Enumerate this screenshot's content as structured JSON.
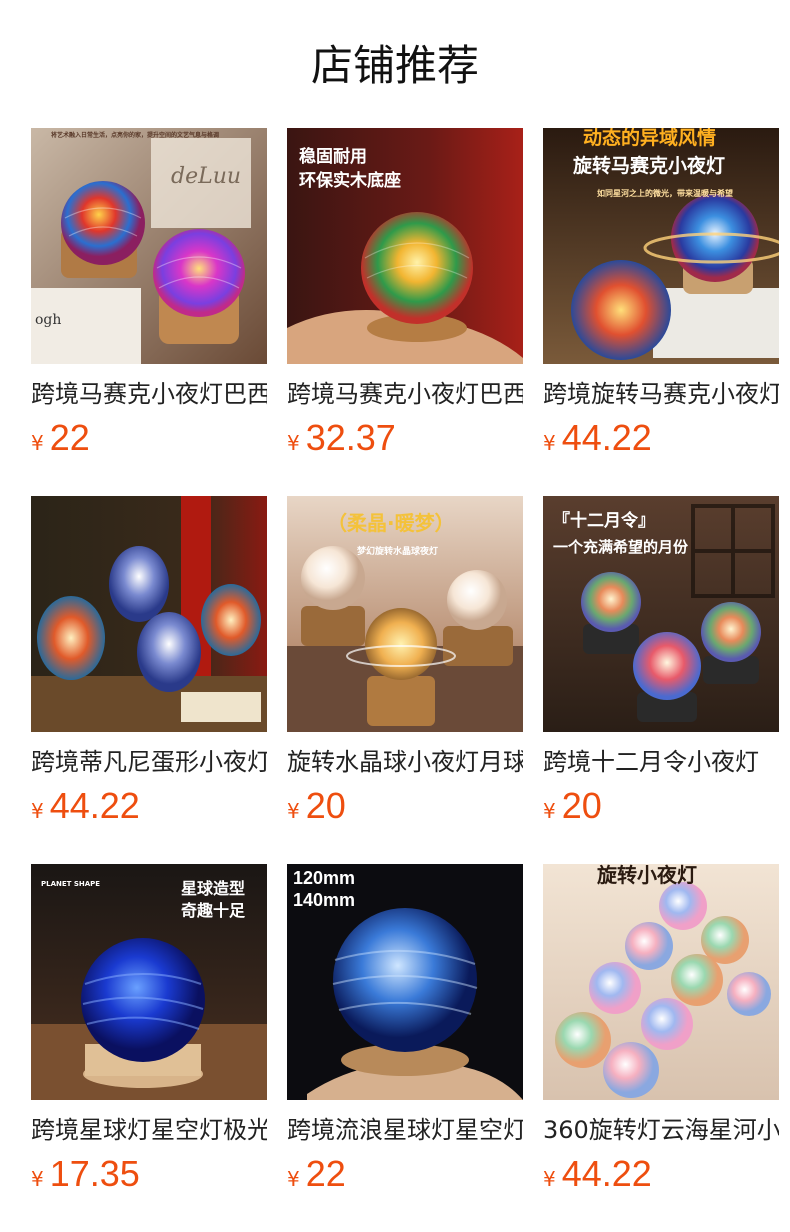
{
  "header": {
    "title": "店铺推荐"
  },
  "currency_symbol": "¥",
  "products": [
    {
      "name": "跨境马赛克小夜灯巴西",
      "price": "22",
      "image": {
        "subject": "mosaic-egg-lamps",
        "overlay": "将艺术融入日常生活，点亮你的家，提升空间的文艺气息与格调"
      }
    },
    {
      "name": "跨境马赛克小夜灯巴西",
      "price": "32.37",
      "image": {
        "subject": "mosaic-ball-in-hand",
        "overlay": "稳固耐用 环保实木底座"
      }
    },
    {
      "name": "跨境旋转马赛克小夜灯",
      "price": "44.22",
      "image": {
        "subject": "rotating-mosaic-lamps",
        "overlay": "动态的异域风情 旋转马赛克小夜灯"
      }
    },
    {
      "name": "跨境蒂凡尼蛋形小夜灯",
      "price": "44.22",
      "image": {
        "subject": "tiffany-egg-lamps",
        "overlay": ""
      }
    },
    {
      "name": "旋转水晶球小夜灯月球",
      "price": "20",
      "image": {
        "subject": "crystal-balls",
        "overlay": "（柔晶·暖梦） 梦幻旋转水晶球夜灯"
      }
    },
    {
      "name": "跨境十二月令小夜灯",
      "price": "20",
      "image": {
        "subject": "swirl-ball-lamps",
        "overlay": "『十二月令』 一个充满希望的月份"
      }
    },
    {
      "name": "跨境星球灯星空灯极光",
      "price": "17.35",
      "image": {
        "subject": "blue-planet-lamp",
        "overlay": "PLANET SHAPE 星球造型 奇趣十足"
      }
    },
    {
      "name": "跨境流浪星球灯星空灯",
      "price": "22",
      "image": {
        "subject": "blue-planet-in-hand",
        "overlay": "120mm 140mm"
      }
    },
    {
      "name": "360旋转灯云海星河小",
      "price": "44.22",
      "image": {
        "subject": "pastel-swirl-balls",
        "overlay": "旋转小夜灯"
      }
    }
  ]
}
